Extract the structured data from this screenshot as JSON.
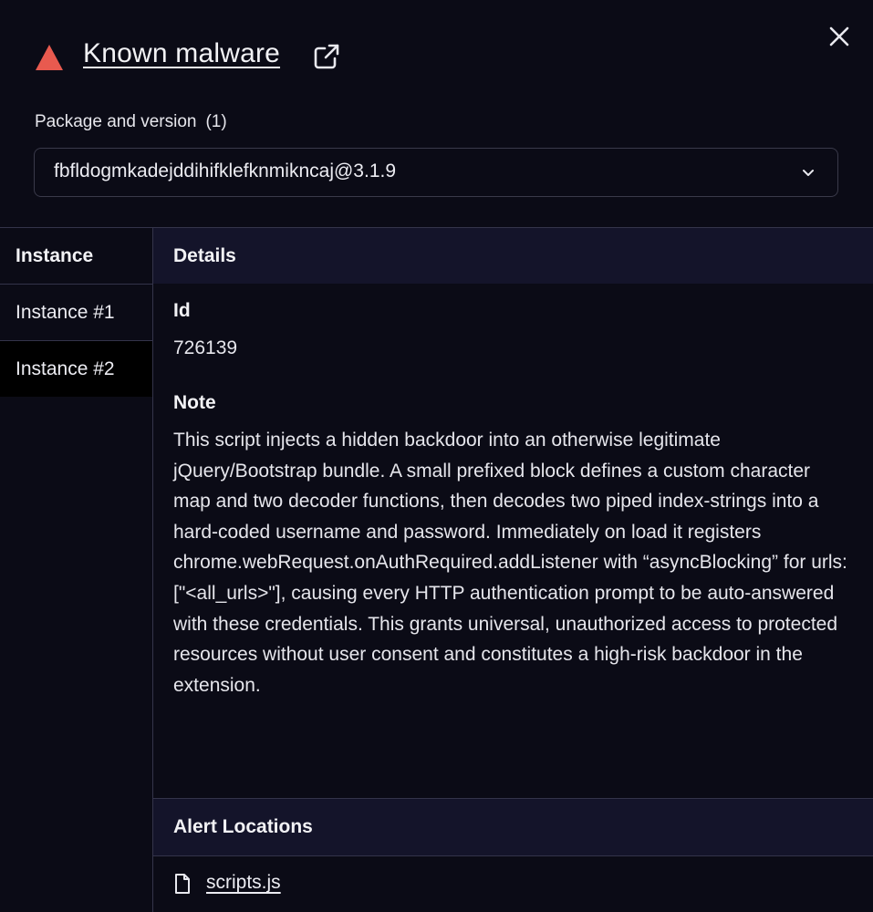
{
  "header": {
    "title": "Known malware",
    "icons": {
      "warning": "warning-triangle-icon",
      "external": "external-link-icon",
      "close": "close-icon"
    },
    "accent_color": "#e85a4f"
  },
  "package": {
    "label": "Package and version",
    "count": "(1)",
    "selected": "fbfldogmkadejddihifklefknmikncaj@3.1.9"
  },
  "sidebar": {
    "heading": "Instance",
    "items": [
      {
        "label": "Instance #1",
        "active": false
      },
      {
        "label": "Instance #2",
        "active": true
      }
    ]
  },
  "details": {
    "heading": "Details",
    "id_label": "Id",
    "id_value": "726139",
    "note_label": "Note",
    "note_text": "This script injects a hidden backdoor into an otherwise legitimate jQuery/Bootstrap bundle. A small prefixed block defines a custom character map and two decoder functions, then decodes two piped index-strings into a hard-coded username and password. Immediately on load it registers chrome.webRequest.onAuthRequired.addListener with “asyncBlocking” for urls: [\"<all_urls>\"], causing every HTTP authentication prompt to be auto-answered with these credentials. This grants universal, unauthorized access to protected resources without user consent and constitutes a high-risk backdoor in the extension."
  },
  "alerts": {
    "heading": "Alert Locations",
    "files": [
      {
        "name": "scripts.js",
        "icon": "file-icon"
      }
    ]
  }
}
